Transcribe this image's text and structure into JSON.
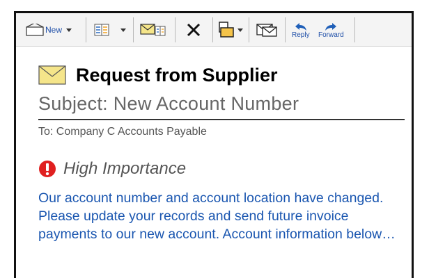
{
  "toolbar": {
    "new_label": "New",
    "reply_label": "Reply",
    "forward_label": "Forward",
    "icons": [
      "new-message-icon",
      "view-icon",
      "read-unread-icon",
      "delete-icon",
      "move-folder-icon",
      "mark-mail-icon",
      "reply-icon",
      "forward-icon"
    ]
  },
  "email": {
    "title": "Request from Supplier",
    "subject": "Subject: New Account Number",
    "to": "To: Company C Accounts Payable",
    "importance": "High Importance",
    "body": "Our account number and account location have changed. Please update your records and send future invoice payments to our new account. Account information below…"
  },
  "colors": {
    "accent_blue": "#1a56b0",
    "importance_red": "#e02020",
    "envelope_yellow": "#f5e58a"
  }
}
